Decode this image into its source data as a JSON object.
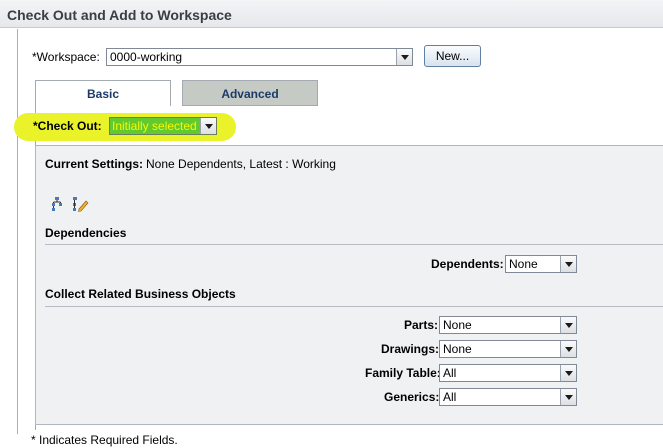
{
  "window": {
    "title": "Check Out and Add to Workspace"
  },
  "workspace": {
    "label": "*Workspace:",
    "value": "0000-working",
    "new_button": "New..."
  },
  "tabs": [
    {
      "label": "Basic"
    },
    {
      "label": "Advanced"
    }
  ],
  "checkout": {
    "label": "*Check Out:",
    "value": "Initially selected",
    "highlight_color": "#eaf22a"
  },
  "settings": {
    "label": "Current Settings:",
    "value": "None Dependents, Latest : Working"
  },
  "toolbar": {
    "icons": [
      "structure-tree-icon",
      "edit-structure-icon"
    ]
  },
  "dependencies": {
    "heading": "Dependencies",
    "dependents_label": "Dependents:",
    "dependents_value": "None"
  },
  "related": {
    "heading": "Collect Related Business Objects",
    "fields": [
      {
        "label": "Parts:",
        "value": "None"
      },
      {
        "label": "Drawings:",
        "value": "None"
      },
      {
        "label": "Family Table:",
        "value": "All"
      },
      {
        "label": "Generics:",
        "value": "All"
      }
    ]
  },
  "footer": {
    "note": "* Indicates Required Fields."
  }
}
